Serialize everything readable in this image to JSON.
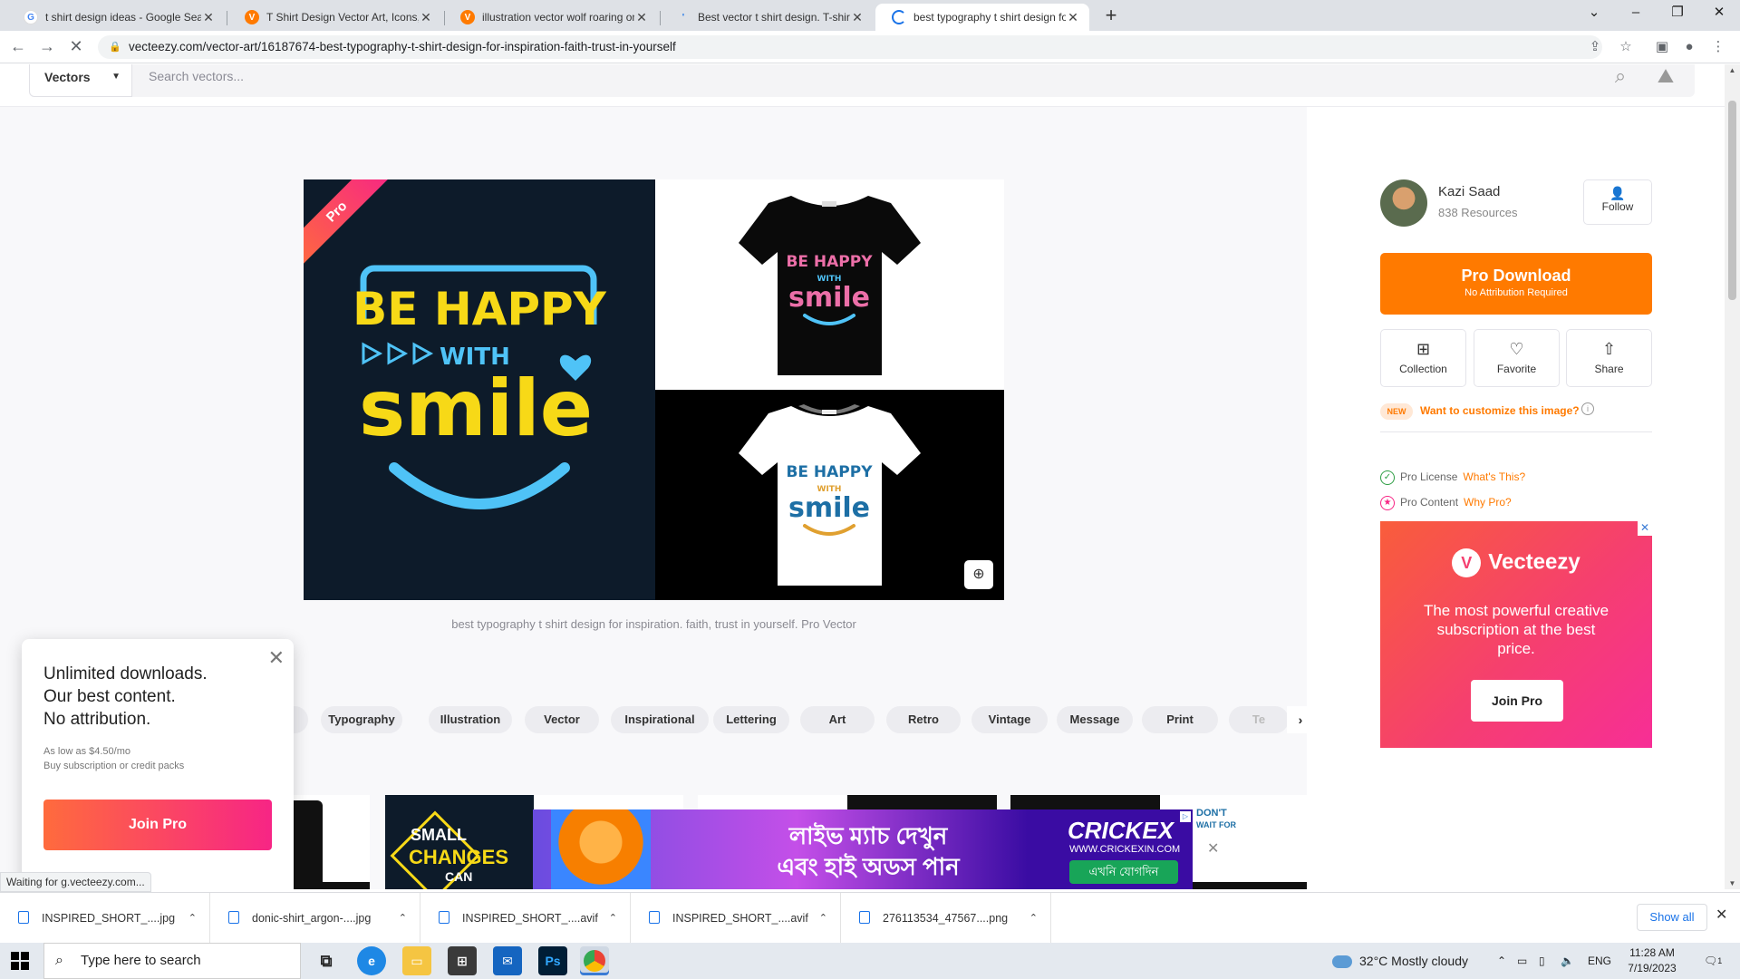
{
  "browser": {
    "tabs": [
      {
        "title": "t shirt design ideas - Google Sea",
        "favicon": "G",
        "favicon_color": "#4285f4",
        "active": false
      },
      {
        "title": "T Shirt Design Vector Art, Icons, a",
        "favicon": "V",
        "favicon_color": "#ff7a00",
        "active": false
      },
      {
        "title": "illustration vector wolf roaring on",
        "favicon": "V",
        "favicon_color": "#ff7a00",
        "active": false
      },
      {
        "title": "Best vector t shirt design. T-shirt",
        "favicon": "'",
        "favicon_color": "#1a73e8",
        "active": false
      },
      {
        "title": "best typography t shirt design fo",
        "favicon": "loading",
        "favicon_color": "#1a73e8",
        "active": true
      }
    ],
    "url": "vecteezy.com/vector-art/16187674-best-typography-t-shirt-design-for-inspiration-faith-trust-in-yourself",
    "status": "Waiting for g.vecteezy.com..."
  },
  "search": {
    "category": "Vectors",
    "placeholder": "Search vectors..."
  },
  "preview": {
    "badge": "Pro",
    "artwork_text_line1": "BE HAPPY",
    "artwork_text_line2": "WITH",
    "artwork_text_line3": "smile",
    "caption": "best typography t shirt design for inspiration. faith, trust in yourself. Pro Vector"
  },
  "tags": [
    "c",
    "Typography",
    "Illustration",
    "Vector",
    "Inspirational",
    "Lettering",
    "Art",
    "Retro",
    "Vintage",
    "Message",
    "Print",
    "Te"
  ],
  "sidebar": {
    "author_name": "Kazi Saad",
    "author_resources": "838 Resources",
    "follow_label": "Follow",
    "pro_download_label": "Pro Download",
    "pro_download_sub": "No Attribution Required",
    "actions": [
      {
        "label": "Collection",
        "icon": "collection-icon"
      },
      {
        "label": "Favorite",
        "icon": "heart-icon"
      },
      {
        "label": "Share",
        "icon": "share-icon"
      }
    ],
    "new_badge": "NEW",
    "customize_label": "Want to customize this image?",
    "license_label": "Pro License",
    "license_link": "What's This?",
    "content_label": "Pro Content",
    "content_link": "Why Pro?"
  },
  "side_ad": {
    "brand": "Vecteezy",
    "tagline": "The most powerful creative subscription at the best price.",
    "cta": "Join Pro"
  },
  "popup": {
    "line1": "Unlimited downloads.",
    "line2": "Our best content.",
    "line3": "No attribution.",
    "price": "As low as $4.50/mo",
    "packs": "Buy subscription or credit packs",
    "cta": "Join Pro"
  },
  "banner_ad": {
    "text_line1": "লাইভ ম্যাচ দেখুন",
    "text_line2": "এবং হাই অডস পান",
    "brand": "CRICKEX",
    "url": "WWW.CRICKEXIN.COM",
    "cta": "এখনি যোগদিন"
  },
  "related": {
    "card2_line1": "SMALL",
    "card2_line2": "CHANGES",
    "card2_line3": "CAN",
    "card_last_line1": "DON'T",
    "card_last_line2": "WAIT FOR"
  },
  "downloads": {
    "items": [
      "INSPIRED_SHORT_....jpg",
      "donic-shirt_argon-....jpg",
      "INSPIRED_SHORT_....avif",
      "INSPIRED_SHORT_....avif",
      "276113534_47567....png"
    ],
    "show_all": "Show all"
  },
  "taskbar": {
    "search_placeholder": "Type here to search",
    "weather": "32°C  Mostly cloudy",
    "language": "ENG",
    "time": "11:28 AM",
    "date": "7/19/2023",
    "notification_count": "1"
  },
  "colors": {
    "brand_orange": "#ff7a00",
    "pro_gradient_start": "#ff6b3d",
    "pro_gradient_end": "#f72585",
    "art_yellow": "#f7d917",
    "art_blue": "#4fc3f7",
    "art_pink": "#ec6fa8"
  }
}
